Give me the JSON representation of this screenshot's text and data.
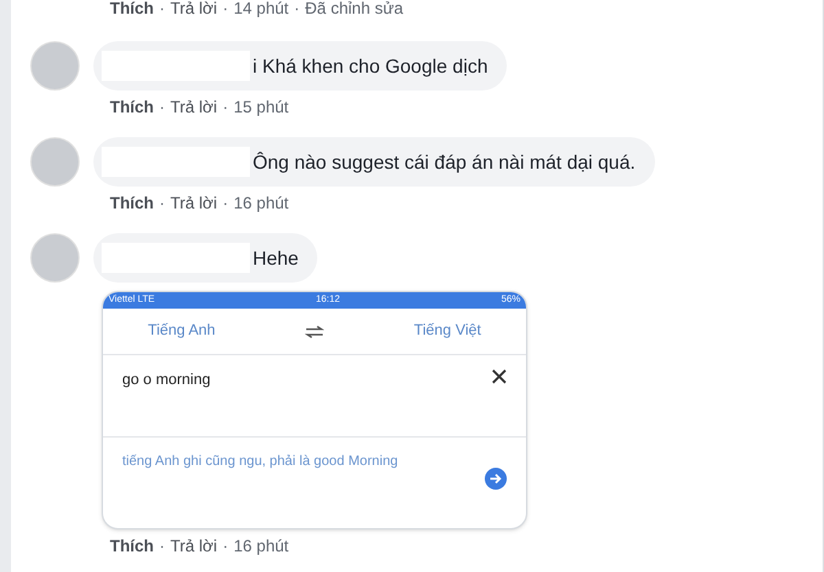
{
  "top_actions": [
    "Thích",
    "·",
    "Trả lời",
    "·",
    "14 phút",
    "·",
    "Đã chỉnh sửa"
  ],
  "comments": [
    {
      "text": "i Khá khen cho Google dịch",
      "actions": [
        "Thích",
        "·",
        "Trả lời",
        "·",
        "15 phút"
      ]
    },
    {
      "text": "Ông nào suggest cái đáp án nài mát dại quá.",
      "actions": [
        "Thích",
        "·",
        "Trả lời",
        "·",
        "16 phút"
      ]
    },
    {
      "text": "Hehe",
      "actions": [
        "Thích",
        "·",
        "Trả lời",
        "·",
        "16 phút"
      ],
      "attachment": {
        "carrier": "Viettel  LTE",
        "clock": "16:12",
        "battery": "56%",
        "source_lang": "Tiếng Anh",
        "target_lang": "Tiếng Việt",
        "input": "go o morning",
        "output": "tiếng Anh ghi cũng ngu, phải là good Morning"
      }
    }
  ]
}
